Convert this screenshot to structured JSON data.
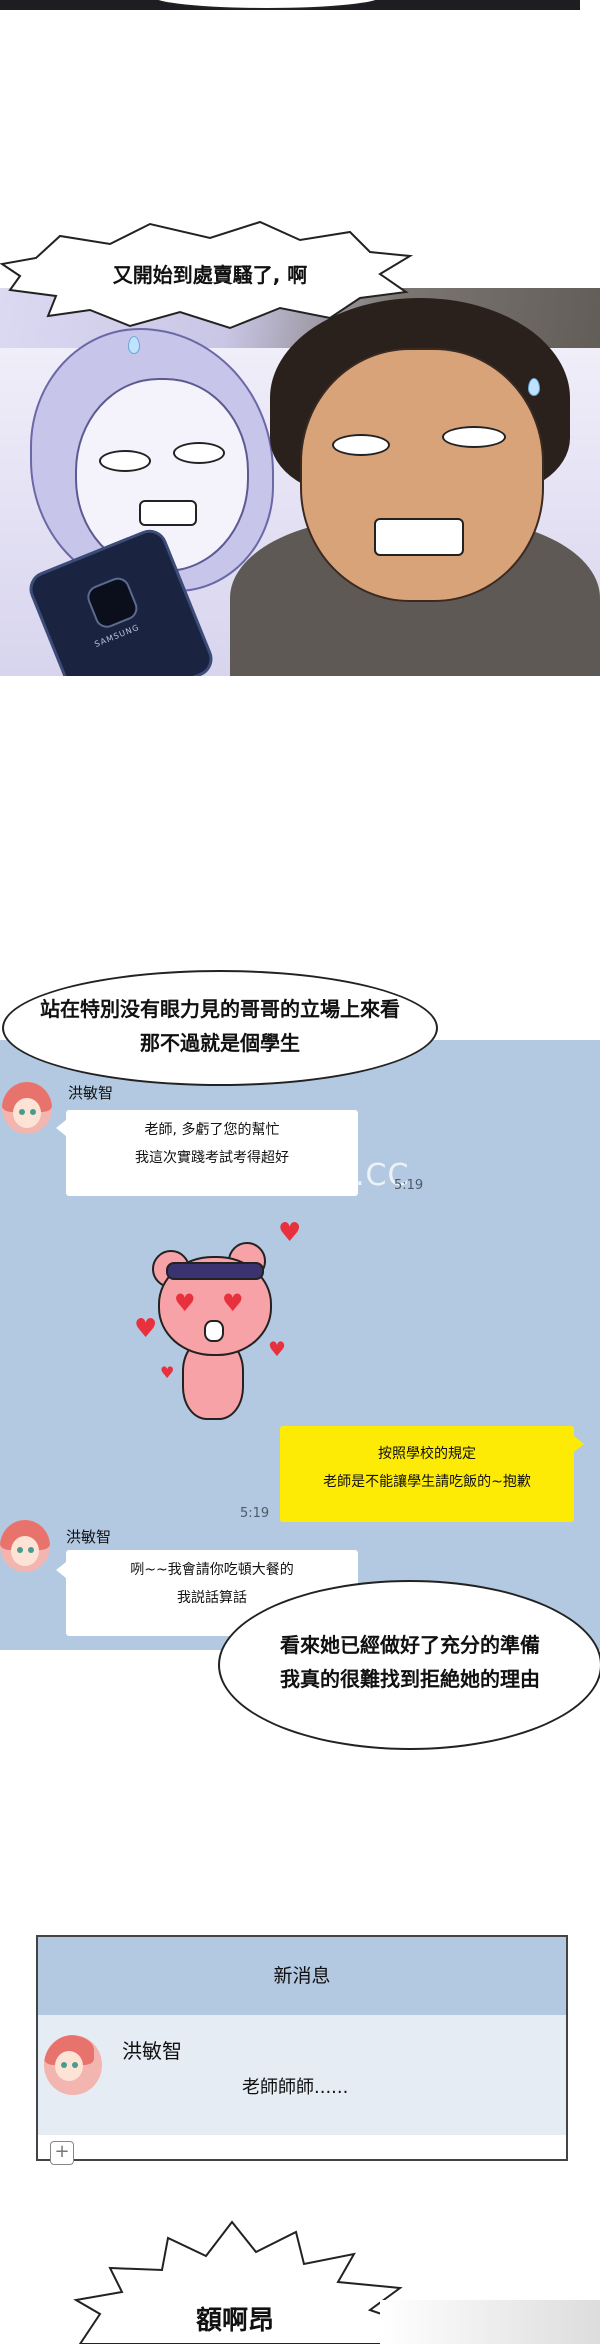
{
  "panel1": {
    "shout": "又開始到處賣騷了, 啊",
    "phone_brand": "SAMSUNG"
  },
  "narration1": {
    "line1": "站在特別没有眼力見的哥哥的立場上來看",
    "line2": "那不過就是個學生"
  },
  "chat": {
    "sender_name": "洪敏智",
    "msg1_line1": "老師, 多虧了您的幫忙",
    "msg1_line2": "我這次實踐考試考得超好",
    "watermark": "TOPTOON.CC",
    "msg1_time": "5:19",
    "reply_line1": "按照學校的規定",
    "reply_line2": "老師是不能讓學生請吃飯的~抱歉",
    "reply_time": "5:19",
    "sender_name_2": "洪敏智",
    "msg2_line1": "咧~~我會請你吃頓大餐的",
    "msg2_line2": "我説話算話"
  },
  "narration2": {
    "line1": "看來她已經做好了充分的準備",
    "line2": "我真的很難找到拒絶她的理由"
  },
  "notification": {
    "title": "新消息",
    "sender": "洪敏智",
    "body": "老師師師......"
  },
  "bottom_shout": "額啊昂",
  "colors": {
    "chat_bg": "#b3c9e1",
    "reply_bubble": "#fdeb05",
    "notification_bg": "#e6ecf4"
  }
}
